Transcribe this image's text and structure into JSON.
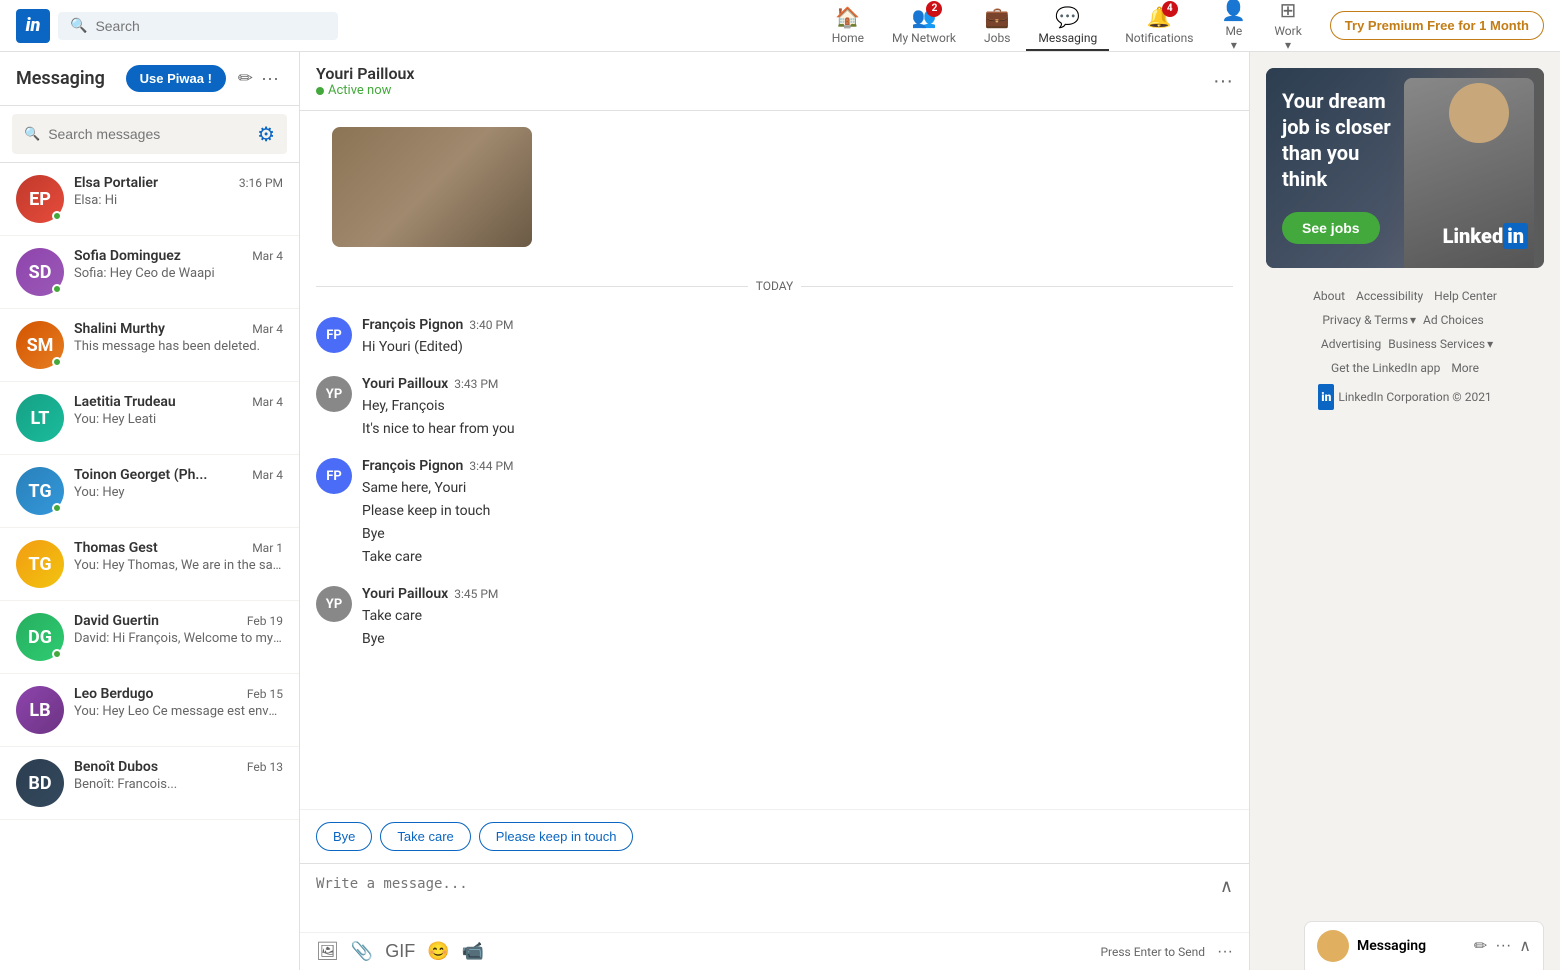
{
  "nav": {
    "logo_text": "in",
    "search_placeholder": "Search",
    "items": [
      {
        "id": "home",
        "label": "Home",
        "icon": "🏠",
        "badge": null,
        "active": false
      },
      {
        "id": "network",
        "label": "My Network",
        "icon": "👥",
        "badge": null,
        "active": false
      },
      {
        "id": "jobs",
        "label": "Jobs",
        "icon": "💼",
        "badge": null,
        "active": false
      },
      {
        "id": "messaging",
        "label": "Messaging",
        "icon": "💬",
        "badge": null,
        "active": true
      },
      {
        "id": "notifications",
        "label": "Notifications",
        "icon": "🔔",
        "badge": "4",
        "active": false
      },
      {
        "id": "me",
        "label": "Me",
        "icon": "👤",
        "badge": null,
        "active": false
      },
      {
        "id": "work",
        "label": "Work",
        "icon": "⊞",
        "badge": null,
        "active": false
      }
    ],
    "premium_label": "Try Premium Free for 1 Month"
  },
  "messaging": {
    "title": "Messaging",
    "use_piwaa_label": "Use Piwaa !",
    "search_placeholder": "Search messages",
    "conversations": [
      {
        "id": 1,
        "name": "Elsa Portalier",
        "preview": "Elsa: Hi",
        "time": "3:16 PM",
        "online": true,
        "initials": "EP",
        "color_class": "avatar-elsa"
      },
      {
        "id": 2,
        "name": "Sofia Dominguez",
        "preview": "Sofia: Hey Ceo de Waapi",
        "time": "Mar 4",
        "online": true,
        "initials": "SD",
        "color_class": "avatar-sofia"
      },
      {
        "id": 3,
        "name": "Shalini Murthy",
        "preview": "This message has been deleted.",
        "time": "Mar 4",
        "online": true,
        "initials": "SM",
        "color_class": "avatar-shalini"
      },
      {
        "id": 4,
        "name": "Laetitia Trudeau",
        "preview": "You: Hey Leati",
        "time": "Mar 4",
        "online": false,
        "initials": "LT",
        "color_class": "avatar-laetitia"
      },
      {
        "id": 5,
        "name": "Toinon Georget (Ph...",
        "preview": "You: Hey",
        "time": "Mar 4",
        "online": true,
        "initials": "TG",
        "color_class": "avatar-toinon"
      },
      {
        "id": 6,
        "name": "Thomas Gest",
        "preview": "You: Hey Thomas, We are in the same pod. Let's connecti...",
        "time": "Mar 1",
        "online": false,
        "initials": "TG",
        "color_class": "avatar-thomas"
      },
      {
        "id": 7,
        "name": "David Guertin",
        "preview": "David: Hi François, Welcome to my network and the...",
        "time": "Feb 19",
        "online": true,
        "initials": "DG",
        "color_class": "avatar-david"
      },
      {
        "id": 8,
        "name": "Leo Berdugo",
        "preview": "You: Hey Leo Ce message est envoyé avec Salehub, un out...",
        "time": "Feb 15",
        "online": false,
        "initials": "LB",
        "color_class": "avatar-leo"
      },
      {
        "id": 9,
        "name": "Benoît Dubos",
        "preview": "Benoît: Francois...",
        "time": "Feb 13",
        "online": false,
        "initials": "BD",
        "color_class": "avatar-benoit"
      }
    ]
  },
  "chat": {
    "contact_name": "Youri Pailloux",
    "status": "Active now",
    "today_label": "TODAY",
    "messages": [
      {
        "id": 1,
        "sender": "François Pignon",
        "time": "3:40 PM",
        "lines": [
          "Hi Youri (Edited)"
        ],
        "avatar_initials": "FP",
        "is_self": false
      },
      {
        "id": 2,
        "sender": "Youri Pailloux",
        "time": "3:43 PM",
        "lines": [
          "Hey, François",
          "It's nice to hear from you"
        ],
        "avatar_initials": "YP",
        "is_self": true
      },
      {
        "id": 3,
        "sender": "François Pignon",
        "time": "3:44 PM",
        "lines": [
          "Same here, Youri",
          "Please keep in touch",
          "Bye",
          "Take care"
        ],
        "avatar_initials": "FP",
        "is_self": false
      },
      {
        "id": 4,
        "sender": "Youri Pailloux",
        "time": "3:45 PM",
        "lines": [
          "Take care",
          "Bye"
        ],
        "avatar_initials": "YP",
        "is_self": true
      }
    ],
    "suggested_replies": [
      "Bye",
      "Take care",
      "Please keep in touch"
    ],
    "write_placeholder": "Write a message...",
    "press_enter_label": "Press Enter to Send"
  },
  "ad": {
    "headline_line1": "Your dream",
    "headline_line2": "job is closer",
    "headline_line3": "than you",
    "headline_line4": "think",
    "cta_label": "See jobs",
    "logo_text": "Linked",
    "logo_in": "in"
  },
  "footer": {
    "links": [
      "About",
      "Accessibility",
      "Help Center",
      "Privacy & Terms",
      "Ad Choices",
      "Advertising",
      "Business Services",
      "Get the LinkedIn app",
      "More"
    ],
    "copyright": "LinkedIn Corporation © 2021"
  },
  "bottom_widget": {
    "title": "Messaging",
    "edit_label": "✏",
    "more_label": "..."
  }
}
